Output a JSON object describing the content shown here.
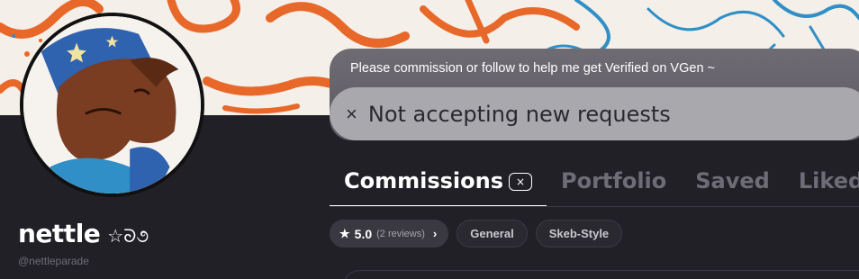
{
  "profile": {
    "name": "nettle",
    "name_decoration": "☆ᘐ૭",
    "handle": "@nettleparade"
  },
  "notice": {
    "message": "Please commission or follow to help me get Verified on VGen ~",
    "status_icon": "×",
    "status": "Not accepting new requests"
  },
  "tabs": [
    {
      "label": "Commissions",
      "badge": "×",
      "active": true
    },
    {
      "label": "Portfolio"
    },
    {
      "label": "Saved"
    },
    {
      "label": "Liked"
    }
  ],
  "chips": {
    "rating_icon": "star-icon",
    "rating_score": "5.0",
    "rating_reviews": "(2 reviews)",
    "rating_chevron": "›",
    "tags": [
      "General",
      "Skeb-Style"
    ]
  },
  "colors": {
    "background": "#212027",
    "banner_orange": "#e8682a",
    "banner_blue": "#2f8fc6",
    "pill": "#a9a8ad"
  }
}
